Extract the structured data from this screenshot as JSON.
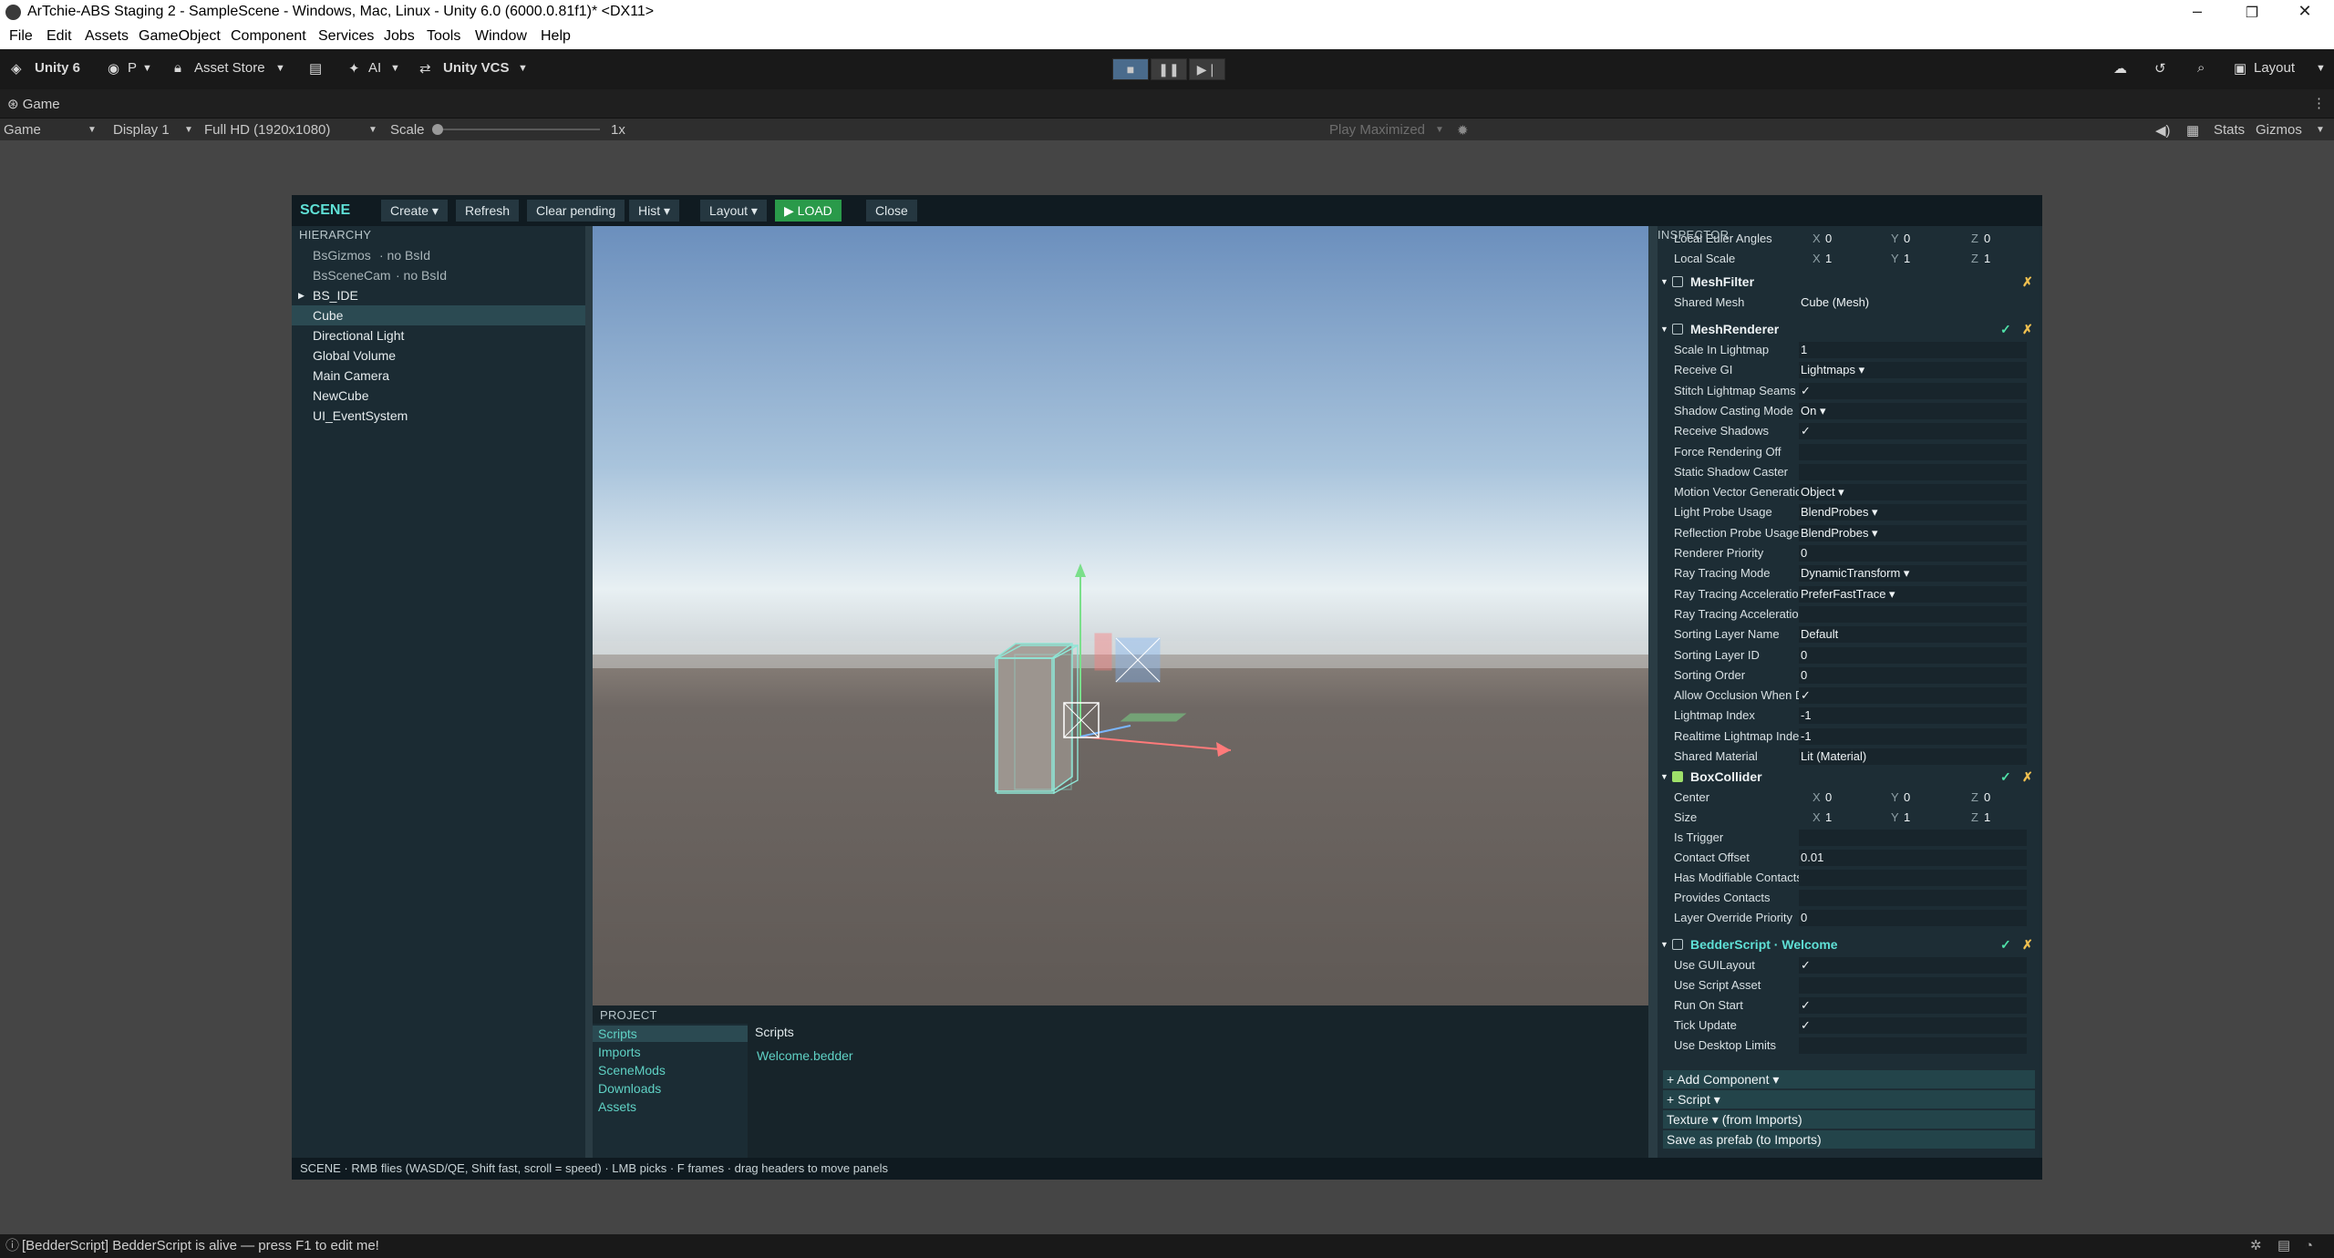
{
  "window": {
    "title": "ArTchie-ABS Staging 2 - SampleScene - Windows, Mac, Linux - Unity 6.0 (6000.0.81f1)* <DX11>",
    "controls": [
      "–",
      "❐",
      "✕"
    ]
  },
  "menu": [
    "File",
    "Edit",
    "Assets",
    "GameObject",
    "Component",
    "Services",
    "Jobs",
    "Tools",
    "Window",
    "Help"
  ],
  "toolbar": {
    "unity_label": "Unity 6",
    "account_label": "P",
    "asset_store": "Asset Store",
    "ai_label": "AI",
    "vcs_label": "Unity VCS",
    "layout_label": "Layout"
  },
  "game_tab": {
    "tab_label": "Game",
    "mode": "Game",
    "display": "Display 1",
    "resolution": "Full HD (1920x1080)",
    "scale_label": "Scale",
    "scale_value": "1x",
    "play_maximized": "Play Maximized",
    "stats": "Stats",
    "gizmos": "Gizmos"
  },
  "scene_bar": {
    "title": "SCENE",
    "buttons": [
      "Create ▾",
      "Refresh",
      "Clear pending",
      "Hist ▾",
      "Layout ▾",
      "▶ LOAD",
      "Close"
    ],
    "load_color": "#2a9a4a"
  },
  "hierarchy": {
    "heading": "HIERARCHY",
    "items": [
      {
        "name": "BsGizmos",
        "note": "· no BsId"
      },
      {
        "name": "BsSceneCam",
        "note": "· no BsId"
      },
      {
        "name": "BS_IDE",
        "note": ""
      },
      {
        "name": "Cube",
        "note": ""
      },
      {
        "name": "Directional Light",
        "note": ""
      },
      {
        "name": "Global Volume",
        "note": ""
      },
      {
        "name": "Main Camera",
        "note": ""
      },
      {
        "name": "NewCube",
        "note": ""
      },
      {
        "name": "UI_EventSystem",
        "note": ""
      }
    ]
  },
  "project": {
    "heading": "PROJECT",
    "folders": [
      "Scripts",
      "Imports",
      "SceneMods",
      "Downloads",
      "Assets"
    ],
    "current_folder": "Scripts",
    "files": [
      "Welcome.bedder"
    ]
  },
  "inspector": {
    "heading": "INSPECTOR",
    "transform_rows": [
      {
        "label": "Local Euler Angles",
        "x": "0",
        "y": "0",
        "z": "0"
      },
      {
        "label": "Local Scale",
        "x": "1",
        "y": "1",
        "z": "1"
      }
    ],
    "meshfilter": {
      "title": "MeshFilter",
      "shared_mesh_label": "Shared Mesh",
      "shared_mesh": "Cube  (Mesh)"
    },
    "meshrenderer": {
      "title": "MeshRenderer",
      "rows": [
        {
          "label": "Scale In Lightmap",
          "value": "1"
        },
        {
          "label": "Receive GI",
          "value": "Lightmaps  ▾"
        },
        {
          "label": "Stitch Lightmap Seams",
          "value": "✓"
        },
        {
          "label": "Shadow Casting Mode",
          "value": "On  ▾"
        },
        {
          "label": "Receive Shadows",
          "value": "✓"
        },
        {
          "label": "Force Rendering Off",
          "value": ""
        },
        {
          "label": "Static Shadow Caster",
          "value": ""
        },
        {
          "label": "Motion Vector Generation Mode",
          "value": "Object  ▾"
        },
        {
          "label": "Light Probe Usage",
          "value": "BlendProbes  ▾"
        },
        {
          "label": "Reflection Probe Usage",
          "value": "BlendProbes  ▾"
        },
        {
          "label": "Renderer Priority",
          "value": "0"
        },
        {
          "label": "Ray Tracing Mode",
          "value": "DynamicTransform  ▾"
        },
        {
          "label": "Ray Tracing Acceleration Structure Build Flags",
          "value": "PreferFastTrace  ▾"
        },
        {
          "label": "Ray Tracing Acceleration Structure Build Flags Override",
          "value": ""
        },
        {
          "label": "Sorting Layer Name",
          "value": "Default"
        },
        {
          "label": "Sorting Layer ID",
          "value": "0"
        },
        {
          "label": "Sorting Order",
          "value": "0"
        },
        {
          "label": "Allow Occlusion When Dynamic",
          "value": "✓"
        },
        {
          "label": "Lightmap Index",
          "value": "-1"
        },
        {
          "label": "Realtime Lightmap Index",
          "value": "-1"
        },
        {
          "label": "Shared Material",
          "value": "Lit  (Material)"
        }
      ]
    },
    "boxcollider": {
      "title": "BoxCollider",
      "center": {
        "label": "Center",
        "x": "0",
        "y": "0",
        "z": "0"
      },
      "size": {
        "label": "Size",
        "x": "1",
        "y": "1",
        "z": "1"
      },
      "rows": [
        {
          "label": "Is Trigger",
          "value": ""
        },
        {
          "label": "Contact Offset",
          "value": "0.01"
        },
        {
          "label": "Has Modifiable Contacts",
          "value": ""
        },
        {
          "label": "Provides Contacts",
          "value": ""
        },
        {
          "label": "Layer Override Priority",
          "value": "0"
        }
      ]
    },
    "bedderscript": {
      "title": "BedderScript · Welcome",
      "rows": [
        {
          "label": "Use GUILayout",
          "value": "✓"
        },
        {
          "label": "Use Script Asset",
          "value": ""
        },
        {
          "label": "Run On Start",
          "value": "✓"
        },
        {
          "label": "Tick Update",
          "value": "✓"
        },
        {
          "label": "Use Desktop Limits",
          "value": ""
        }
      ]
    },
    "bottom_buttons": [
      "+ Add Component ▾",
      "+ Script ▾",
      "Texture ▾  (from Imports)",
      "Save as prefab (to Imports)"
    ]
  },
  "status_hint": "SCENE · RMB flies (WASD/QE, Shift fast, scroll = speed) · LMB picks · F frames · drag headers to move panels",
  "console_message": "[BedderScript] BedderScript is alive — press F1 to edit me!"
}
